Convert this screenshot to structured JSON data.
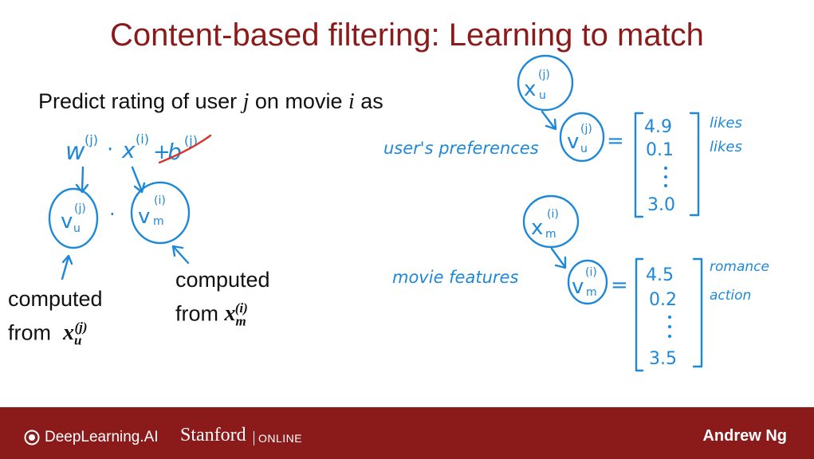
{
  "slide": {
    "title": "Content-based filtering: Learning to match",
    "prompt_prefix": "Predict rating of user ",
    "prompt_j": "j",
    "prompt_mid": " on movie ",
    "prompt_i": "i",
    "prompt_suffix": " as"
  },
  "left_labels": {
    "left_line1": "computed",
    "left_line2": "from",
    "left_var": "x",
    "left_sup": "(j)",
    "left_sub": "u",
    "right_line1": "computed",
    "right_line2": "from",
    "right_var": "x",
    "right_sup": "(i)",
    "right_sub": "m"
  },
  "handwriting": {
    "formula_w": "w",
    "formula_w_sup": "(j)",
    "formula_dot": "·",
    "formula_x": "x",
    "formula_x_sup": "(i)",
    "formula_plus": "+",
    "formula_b": "b",
    "formula_b_sup": "(j)",
    "vu": "v",
    "vu_sup": "(j)",
    "vu_sub": "u",
    "vm": "v",
    "vm_sup": "(i)",
    "vm_sub": "m",
    "xu": "x",
    "xu_sup": "(j)",
    "xu_sub": "u",
    "xm": "x",
    "xm_sup": "(i)",
    "xm_sub": "m",
    "equals": "=",
    "users_preferences": "user's preferences",
    "movie_features": "movie features",
    "user_vector": [
      "4.9",
      "0.1",
      "3.0"
    ],
    "user_vector_labels": [
      "likes",
      "likes"
    ],
    "movie_vector": [
      "4.5",
      "0.2",
      "3.5"
    ],
    "movie_vector_labels": [
      "romance",
      "action"
    ]
  },
  "footer": {
    "brand": "DeepLearning.AI",
    "stanford": "Stanford",
    "online": "ONLINE",
    "presenter": "Andrew Ng"
  },
  "colors": {
    "title": "#8b1a1a",
    "footer": "#8b1a1a",
    "ink_blue": "#1e88d8",
    "ink_red": "#d9342b"
  }
}
